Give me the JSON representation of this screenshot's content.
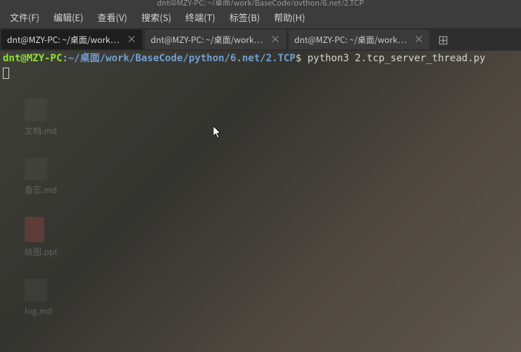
{
  "title_bar": {
    "text": "dnt@MZY-PC: ~/桌面/work/BaseCode/python/6.net/2.TCP"
  },
  "menu": {
    "file": "文件(F)",
    "edit": "编辑(E)",
    "view": "查看(V)",
    "search": "搜索(S)",
    "terminal": "终端(T)",
    "tabs": "标签(B)",
    "help": "帮助(H)"
  },
  "tabs": [
    {
      "label": "dnt@MZY-PC: ~/桌面/work…",
      "active": true
    },
    {
      "label": "dnt@MZY-PC: ~/桌面/work…",
      "active": false
    },
    {
      "label": "dnt@MZY-PC: ~/桌面/work…",
      "active": false
    }
  ],
  "prompt": {
    "user_host": "dnt@MZY-PC",
    "separator": ":",
    "path": "~/桌面/work/BaseCode/python/6.net/2.TCP",
    "symbol": "$",
    "command": " python3 2.tcp_server_thread.py"
  },
  "desktop": {
    "items": [
      {
        "label": "文档.md"
      },
      {
        "label": "备忘.md"
      },
      {
        "label": "绘图.ppt"
      },
      {
        "label": "log.md"
      }
    ]
  }
}
